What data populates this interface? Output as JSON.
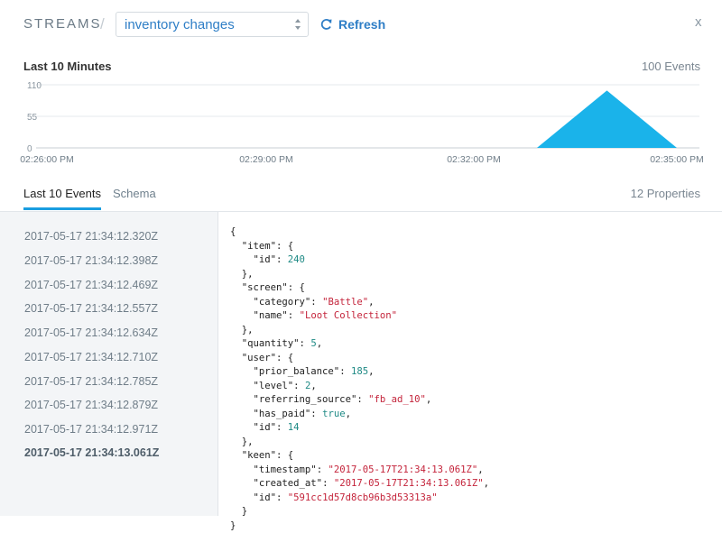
{
  "header": {
    "title": "STREAMS",
    "separator": "/",
    "stream_select": "inventory changes",
    "refresh_label": "Refresh",
    "close_label": "x"
  },
  "chart_header": {
    "title": "Last 10 Minutes",
    "count": "100 Events"
  },
  "chart_data": {
    "type": "area",
    "title": "Last 10 Minutes",
    "y_ticks": [
      "110",
      "55",
      "0"
    ],
    "x_ticks": [
      "02:26:00 PM",
      "02:29:00 PM",
      "02:32:00 PM",
      "02:35:00 PM"
    ],
    "x": [
      "02:33:00 PM",
      "02:34:00 PM",
      "02:35:00 PM"
    ],
    "values": [
      0,
      100,
      0
    ],
    "ylim": [
      0,
      110
    ],
    "fill_color": "#1ab3ea",
    "grid": true
  },
  "tabs": {
    "active": "Last 10 Events",
    "schema": "Schema",
    "properties": "12 Properties"
  },
  "events": [
    "2017-05-17 21:34:12.320Z",
    "2017-05-17 21:34:12.398Z",
    "2017-05-17 21:34:12.469Z",
    "2017-05-17 21:34:12.557Z",
    "2017-05-17 21:34:12.634Z",
    "2017-05-17 21:34:12.710Z",
    "2017-05-17 21:34:12.785Z",
    "2017-05-17 21:34:12.879Z",
    "2017-05-17 21:34:12.971Z",
    "2017-05-17 21:34:13.061Z"
  ],
  "selected_event_index": 9,
  "event_json": {
    "item_id": "240",
    "screen_category": "\"Battle\"",
    "screen_name": "\"Loot Collection\"",
    "quantity": "5",
    "user_prior_balance": "185",
    "user_level": "2",
    "user_referring_source": "\"fb_ad_10\"",
    "user_has_paid": "true",
    "user_id": "14",
    "keen_timestamp": "\"2017-05-17T21:34:13.061Z\"",
    "keen_created_at": "\"2017-05-17T21:34:13.061Z\"",
    "keen_id": "\"591cc1d57d8cb96b3d53313a\""
  },
  "colors": {
    "accent": "#2e7ec6",
    "tab_underline": "#1a9de0",
    "chart_fill": "#1ab3ea"
  }
}
